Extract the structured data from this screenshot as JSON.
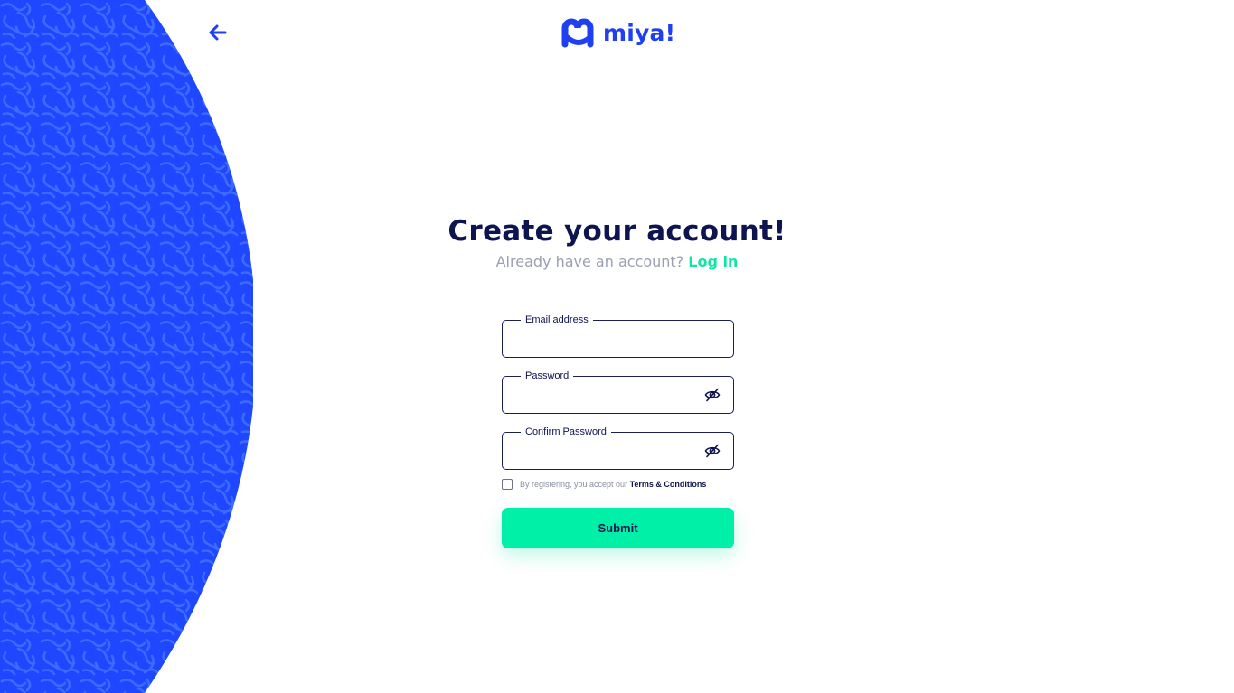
{
  "header": {
    "logo_text": "miya!",
    "brand_color": "#1f3ff0"
  },
  "form": {
    "title": "Create your account!",
    "subtitle_prefix": "Already have an account? ",
    "login_link": "Log in",
    "email": {
      "label": "Email address",
      "value": "",
      "placeholder": ""
    },
    "password": {
      "label": "Password",
      "value": "",
      "placeholder": ""
    },
    "confirm_password": {
      "label": "Confirm Password",
      "value": "",
      "placeholder": ""
    },
    "terms_prefix": "By registering, you accept our ",
    "terms_link": "Terms & Conditions",
    "terms_checked": false,
    "submit_label": "Submit"
  },
  "icons": {
    "back": "arrow-left-icon",
    "password_toggle": "eye-off-icon"
  },
  "colors": {
    "accent": "#00f0a8",
    "link": "#15e3a6",
    "text_dark": "#0e1450",
    "muted": "#9a9eb2"
  }
}
